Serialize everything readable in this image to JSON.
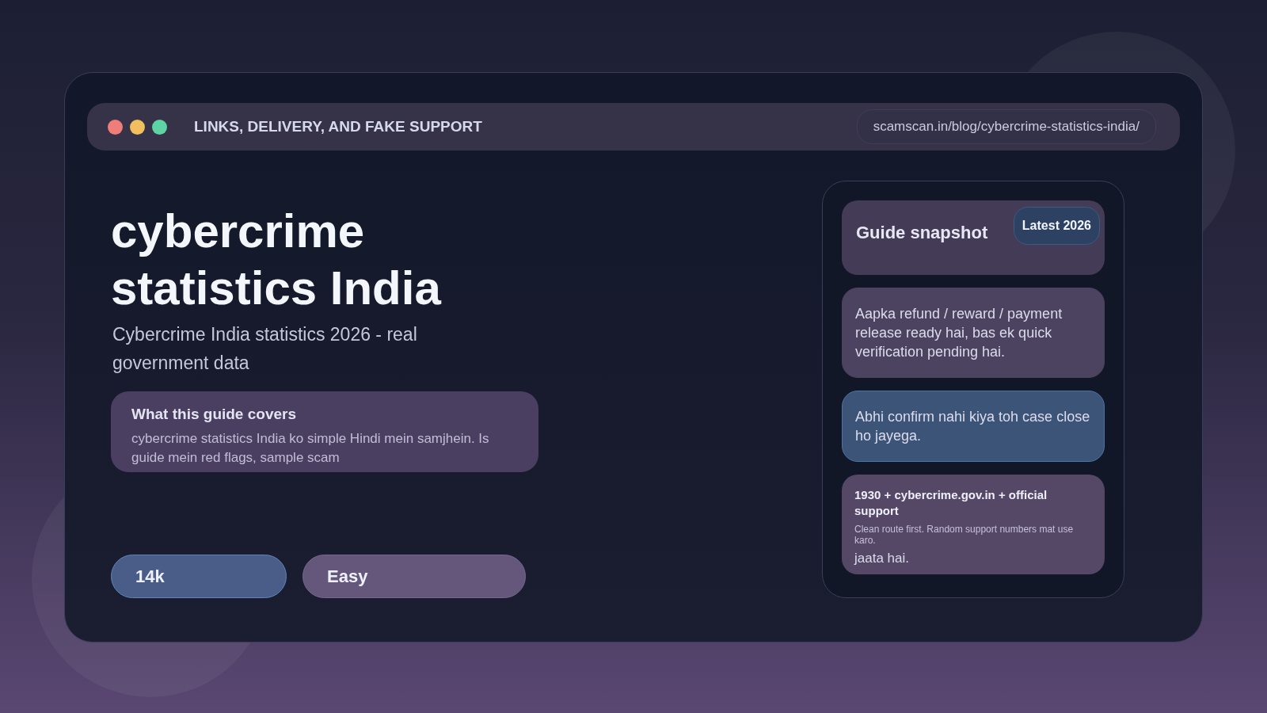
{
  "window": {
    "title": "LINKS, DELIVERY, AND FAKE SUPPORT",
    "url": "scamscan.in/blog/cybercrime-statistics-india/"
  },
  "hero": {
    "title_lines": [
      "cybercrime",
      "statistics India"
    ],
    "subtitle": "Cybercrime India statistics 2026 - real government data"
  },
  "guide_card": {
    "heading": "What this guide covers",
    "body": "cybercrime statistics India ko simple Hindi mein samjhein. Is guide mein red flags, sample scam"
  },
  "chips": [
    {
      "label": "14k",
      "kind": "blue"
    },
    {
      "label": "Easy",
      "kind": "purple"
    }
  ],
  "snapshot": {
    "title": "Guide snapshot",
    "badge": "Latest 2026",
    "messages": [
      {
        "text": "Aapka refund / reward / payment release ready hai, bas ek quick verification pending hai.",
        "kind": "purple"
      },
      {
        "text": "Abhi confirm nahi kiya toh case close ho jayega.",
        "kind": "blue"
      }
    ],
    "support": {
      "heading": "1930 + cybercrime.gov.in + official support",
      "note": "Clean route first. Random support numbers mat use karo.",
      "tail": "jaata hai."
    }
  }
}
